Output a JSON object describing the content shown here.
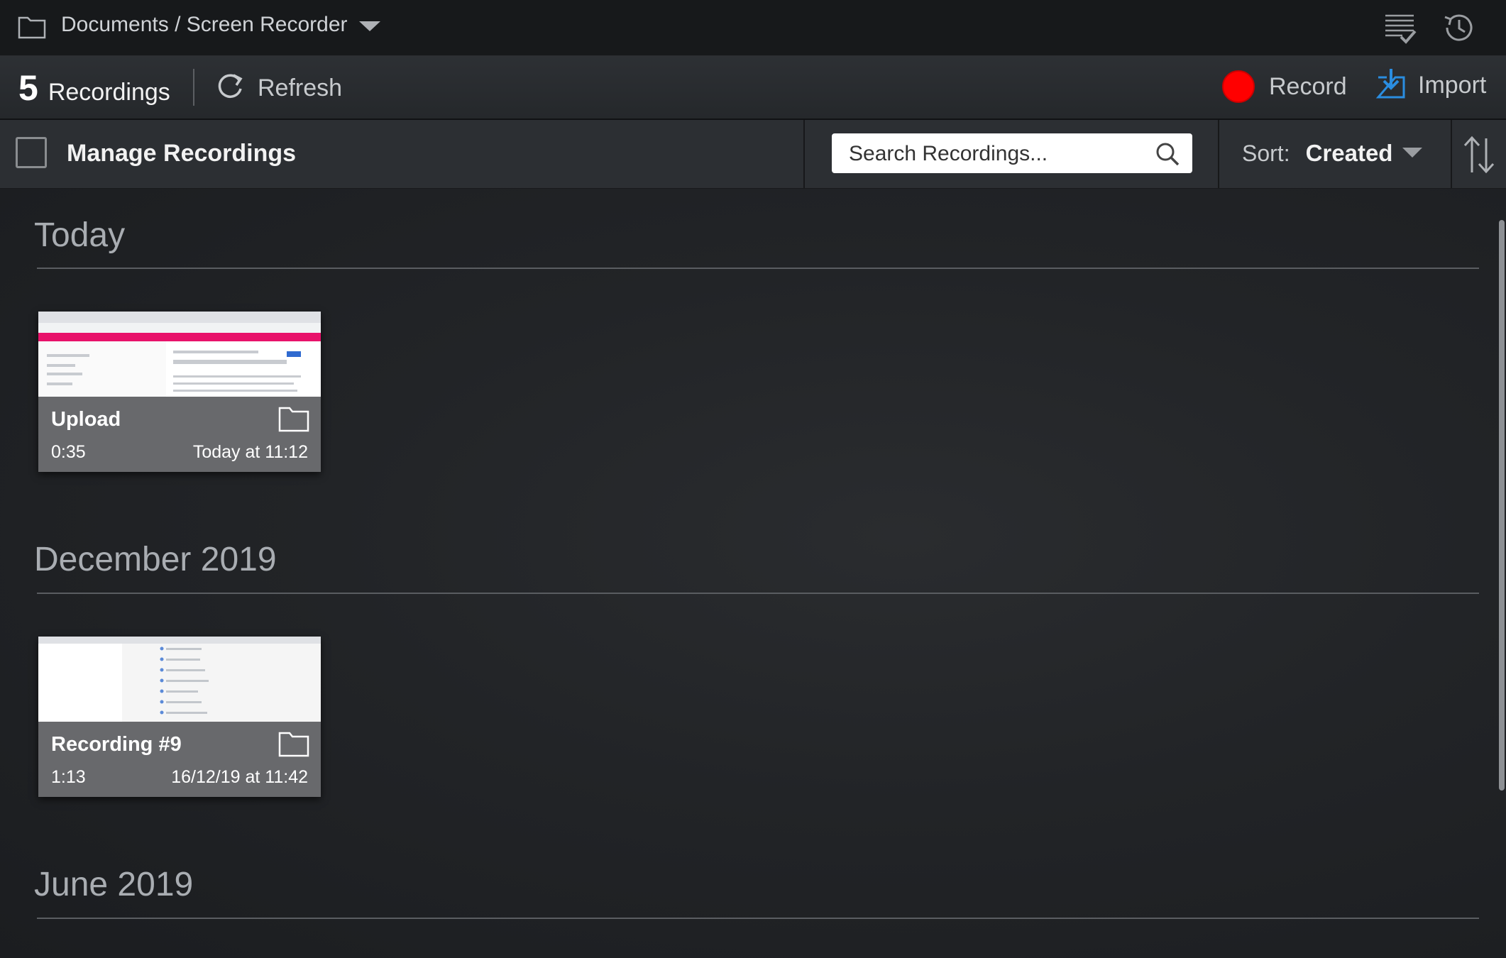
{
  "titlebar": {
    "path": "Documents / Screen Recorder",
    "icons": [
      "folder-icon",
      "chevron-down-icon",
      "tasks-icon",
      "history-icon"
    ]
  },
  "toolbar": {
    "count": "5",
    "count_label": "Recordings",
    "refresh_label": "Refresh",
    "record_label": "Record",
    "import_label": "Import",
    "record_color": "#ff0000",
    "import_icon_color": "#2a8de0"
  },
  "filterbar": {
    "manage_label": "Manage Recordings",
    "manage_checked": false,
    "search_placeholder": "Search Recordings...",
    "sort_label": "Sort:",
    "sort_value": "Created"
  },
  "sections": [
    {
      "title": "Today",
      "recordings": [
        {
          "name": "Upload",
          "duration": "0:35",
          "date": "Today at 11:12"
        }
      ]
    },
    {
      "title": "December 2019",
      "recordings": [
        {
          "name": "Recording #9",
          "duration": "1:13",
          "date": "16/12/19 at 11:42"
        }
      ]
    },
    {
      "title": "June 2019",
      "recordings": []
    }
  ]
}
